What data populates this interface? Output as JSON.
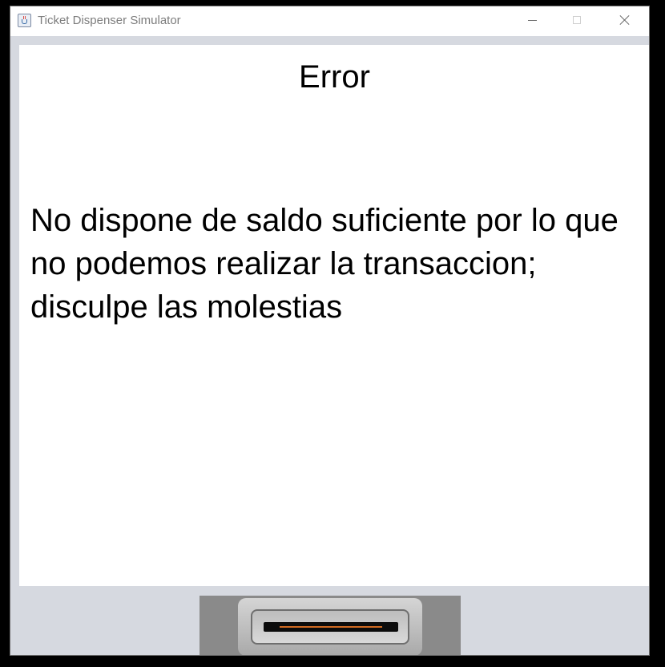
{
  "window": {
    "title": "Ticket Dispenser Simulator",
    "controls": {
      "minimize_icon": "minimize-icon",
      "maximize_icon": "maximize-icon",
      "close_icon": "close-icon"
    }
  },
  "screen": {
    "title": "Error",
    "message": "No dispone de saldo suficiente por lo que no podemos realizar la transaccion; disculpe las molestias"
  },
  "card_slot": {
    "icon": "card-slot-icon",
    "accent_color": "#d06a22"
  }
}
